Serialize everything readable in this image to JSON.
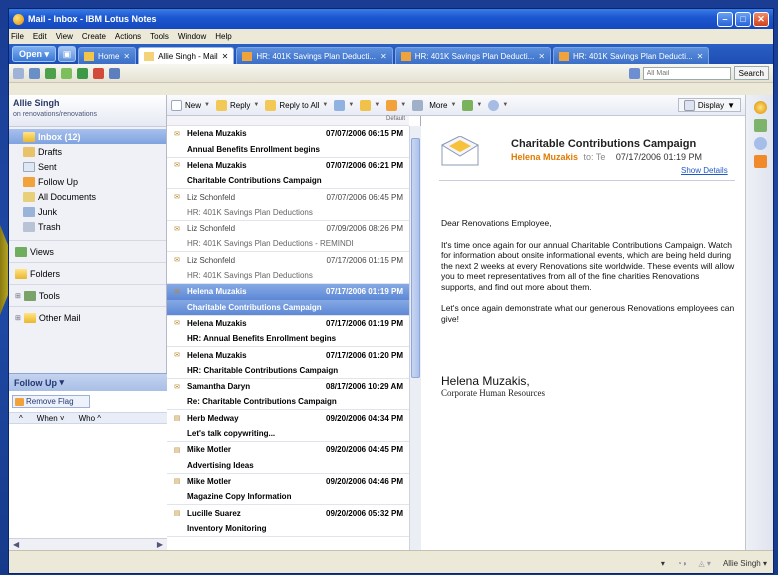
{
  "window": {
    "title": "Mail - Inbox - IBM Lotus Notes"
  },
  "menu": [
    "File",
    "Edit",
    "View",
    "Create",
    "Actions",
    "Tools",
    "Window",
    "Help"
  ],
  "tabs": {
    "open_label": "Open",
    "items": [
      {
        "label": "Home"
      },
      {
        "label": "Allie Singh - Mail"
      },
      {
        "label": "HR: 401K Savings Plan Deducti..."
      },
      {
        "label": "HR: 401K Savings Plan Deducti..."
      },
      {
        "label": "HR: 401K Savings Plan Deducti..."
      }
    ]
  },
  "search": {
    "placeholder": "All Mail",
    "button": "Search"
  },
  "nav": {
    "owner": "Allie Singh",
    "location": "on renovations/renovations",
    "folders": [
      {
        "label": "Inbox (12)",
        "icon": "inbox-icon"
      },
      {
        "label": "Drafts",
        "icon": "drafts-icon"
      },
      {
        "label": "Sent",
        "icon": "sent-icon"
      },
      {
        "label": "Follow Up",
        "icon": "follow-up-flag-icon"
      },
      {
        "label": "All Documents",
        "icon": "all-documents-icon"
      },
      {
        "label": "Junk",
        "icon": "junk-icon"
      },
      {
        "label": "Trash",
        "icon": "trash-icon"
      }
    ],
    "sections": [
      "Views",
      "Folders",
      "Tools",
      "Other Mail"
    ],
    "followup": {
      "title": "Follow Up",
      "remove": "Remove Flag",
      "col_when": "When",
      "col_who": "Who"
    }
  },
  "toolbar": {
    "new": "New",
    "reply": "Reply",
    "reply_all": "Reply to All",
    "more": "More",
    "display": "Display"
  },
  "list": {
    "sort_label": "Default",
    "messages": [
      {
        "from": "Helena Muzakis",
        "date": "07/07/2006 06:15 PM",
        "subject": "Annual Benefits Enrollment begins",
        "read": false,
        "selected": false
      },
      {
        "from": "Helena Muzakis",
        "date": "07/07/2006 06:21 PM",
        "subject": "Charitable Contributions Campaign",
        "read": false,
        "selected": false
      },
      {
        "from": "Liz Schonfeld",
        "date": "07/07/2006 06:45 PM",
        "subject": "HR: 401K Savings Plan Deductions",
        "read": true,
        "selected": false
      },
      {
        "from": "Liz Schonfeld",
        "date": "07/09/2006 08:26 PM",
        "subject": "HR: 401K Savings Plan Deductions - REMINDI",
        "read": true,
        "selected": false
      },
      {
        "from": "Liz Schonfeld",
        "date": "07/17/2006 01:15 PM",
        "subject": "HR: 401K Savings Plan Deductions",
        "read": true,
        "selected": false
      },
      {
        "from": "Helena Muzakis",
        "date": "07/17/2006 01:19 PM",
        "subject": "Charitable Contributions Campaign",
        "read": false,
        "selected": true
      },
      {
        "from": "Helena Muzakis",
        "date": "07/17/2006 01:19 PM",
        "subject": "HR: Annual Benefits Enrollment begins",
        "read": false,
        "selected": false
      },
      {
        "from": "Helena Muzakis",
        "date": "07/17/2006 01:20 PM",
        "subject": "HR: Charitable Contributions Campaign",
        "read": false,
        "selected": false
      },
      {
        "from": "Samantha Daryn",
        "date": "08/17/2006 10:29 AM",
        "subject": "Re: Charitable Contributions Campaign",
        "read": false,
        "selected": false
      },
      {
        "from": "Herb Medway",
        "date": "09/20/2006 04:34 PM",
        "subject": "Let's talk copywriting...",
        "read": false,
        "selected": false
      },
      {
        "from": "Mike Motler",
        "date": "09/20/2006 04:45 PM",
        "subject": "Advertising Ideas",
        "read": false,
        "selected": false
      },
      {
        "from": "Mike Motler",
        "date": "09/20/2006 04:46 PM",
        "subject": "Magazine Copy Information",
        "read": false,
        "selected": false
      },
      {
        "from": "Lucille Suarez",
        "date": "09/20/2006 05:32 PM",
        "subject": "Inventory Monitoring",
        "read": false,
        "selected": false
      }
    ]
  },
  "preview": {
    "title": "Charitable Contributions Campaign",
    "sender": "Helena Muzakis",
    "to_label": "to: Te",
    "date": "07/17/2006 01:19 PM",
    "show_details": "Show Details",
    "greeting": "Dear Renovations Employee,",
    "para1": "It's time once again for our annual Charitable Contributions Campaign.  Watch for information about onsite informational events, which are being held during the next 2 weeks at every Renovations site worldwide.  These events will allow you to meet representatives from all of the fine charities Renovations supports, and find out more about them.",
    "para2": "Let's once again demonstrate what our generous Renovations employees can give!",
    "signature": "Helena Muzakis,",
    "sig_title": "Corporate Human Resources"
  },
  "status": {
    "user": "Allie Singh"
  }
}
